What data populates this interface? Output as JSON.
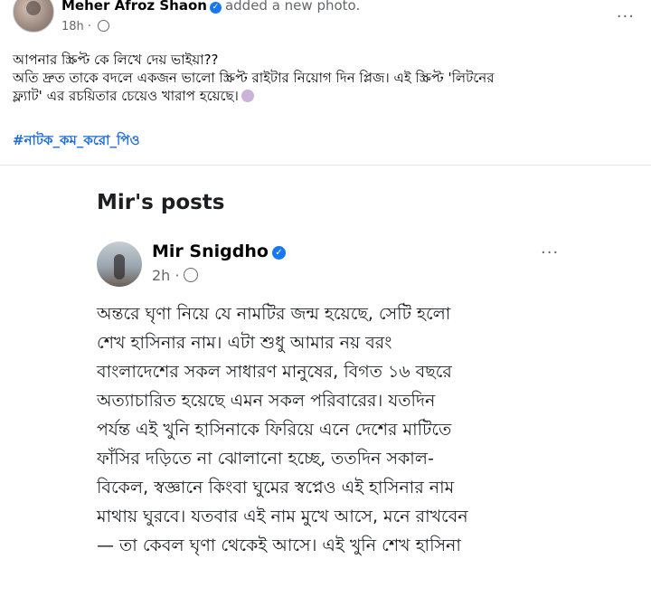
{
  "post": {
    "author": "Meher Afroz Shaon",
    "verified_icon": "verified-badge-icon",
    "action": "added a new photo.",
    "time": "18h",
    "privacy_icon": "globe-icon",
    "more_label": "···",
    "text_line_1": "আপনার স্ক্রিপ্ট কে লিখে দেয় ভাইয়া??",
    "text_line_2": "অতি দ্রুত তাকে বদলে একজন ভালো স্ক্রিপ্ট রাইটার নিয়োগ দিন প্লিজ। এই স্ক্রিপ্ট 'লিটনের",
    "text_line_3": "ফ্ল্যাট' এর রচয়িতার চেয়েও খারাপ হয়েছে।",
    "emoji_icon": "person-facepalm-emoji-icon",
    "hashtag": "#নাটক_কম_করো_পিও"
  },
  "shared_image": {
    "title": "Mir's posts",
    "author": "Mir Snigdho",
    "time": "2h",
    "dot": "·",
    "more_label": "···",
    "body_lines": [
      "অন্তরে ঘৃণা নিয়ে যে নামটির জন্ম হয়েছে, সেটি হলো",
      "শেখ হাসিনার নাম। এটা শুধু আমার নয় বরং",
      "বাংলাদেশের সকল সাধারণ মানুষের, বিগত ১৬ বছরে",
      "অত্যাচারিত হয়েছে এমন সকল পরিবারের। যতদিন",
      "পর্যন্ত এই খুনি হাসিনাকে ফিরিয়ে এনে দেশের মাটিতে",
      "ফাঁসির দড়িতে না ঝোলানো হচ্ছে, ততদিন সকাল-",
      "বিকেল, স্বজ্ঞানে কিংবা ঘুমের স্বপ্নেও এই হাসিনার নাম",
      "মাথায় ঘুরবে। যতবার এই নাম মুখে আসে, মনে রাখবেন",
      "— তা কেবল ঘৃণা থেকেই আসে। এই খুনি শেখ হাসিনা"
    ]
  },
  "colors": {
    "hashtag": "#216fdb",
    "verified": "#1877f2",
    "meta": "#65676b"
  }
}
